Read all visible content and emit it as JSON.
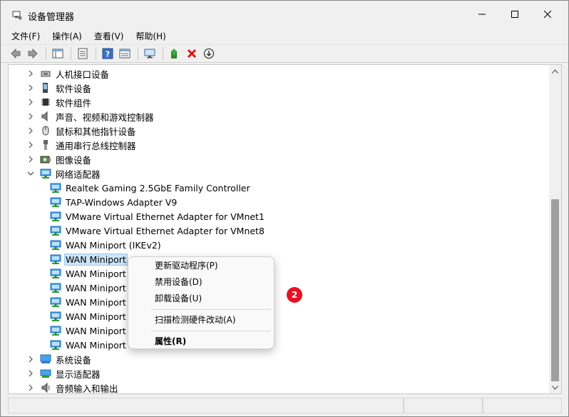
{
  "window": {
    "title": "设备管理器"
  },
  "menubar": {
    "items": [
      "文件(F)",
      "操作(A)",
      "查看(V)",
      "帮助(H)"
    ]
  },
  "toolbar": {
    "buttons": [
      "back-arrow-icon",
      "forward-arrow-icon",
      "show-hide-tree-icon",
      "properties-icon",
      "help-icon",
      "details-icon",
      "monitor-icon",
      "update-driver-icon",
      "uninstall-icon",
      "download-icon"
    ]
  },
  "tree": {
    "categories_top": [
      {
        "label": "人机接口设备",
        "icon": "hid-icon"
      },
      {
        "label": "软件设备",
        "icon": "software-device-icon"
      },
      {
        "label": "软件组件",
        "icon": "software-component-icon"
      },
      {
        "label": "声音、视频和游戏控制器",
        "icon": "speaker-icon"
      },
      {
        "label": "鼠标和其他指针设备",
        "icon": "mouse-icon"
      },
      {
        "label": "通用串行总线控制器",
        "icon": "usb-icon"
      },
      {
        "label": "图像设备",
        "icon": "camera-icon"
      }
    ],
    "network": {
      "label": "网络适配器",
      "children": [
        "Realtek Gaming 2.5GbE Family Controller",
        "TAP-Windows Adapter V9",
        "VMware Virtual Ethernet Adapter for VMnet1",
        "VMware Virtual Ethernet Adapter for VMnet8",
        "WAN Miniport (IKEv2)",
        "WAN Miniport",
        "WAN Miniport",
        "WAN Miniport",
        "WAN Miniport",
        "WAN Miniport",
        "WAN Miniport",
        "WAN Miniport"
      ],
      "selected_index": 5
    },
    "categories_bottom": [
      {
        "label": "系统设备",
        "icon": "system-icon"
      },
      {
        "label": "显示适配器",
        "icon": "display-icon"
      },
      {
        "label": "音频输入和输出",
        "icon": "audio-icon"
      }
    ]
  },
  "context_menu": {
    "items": [
      {
        "label": "更新驱动程序(P)",
        "bold": false
      },
      {
        "label": "禁用设备(D)",
        "bold": false
      },
      {
        "label": "卸载设备(U)",
        "bold": false
      },
      {
        "separator": true
      },
      {
        "label": "扫描检测硬件改动(A)",
        "bold": false
      },
      {
        "separator": true
      },
      {
        "label": "属性(R)",
        "bold": true
      }
    ]
  },
  "annotation": {
    "badge": "2"
  },
  "colors": {
    "selection": "#cce4f7",
    "badge": "#e81123",
    "network_icon": "#1e7fd4"
  }
}
